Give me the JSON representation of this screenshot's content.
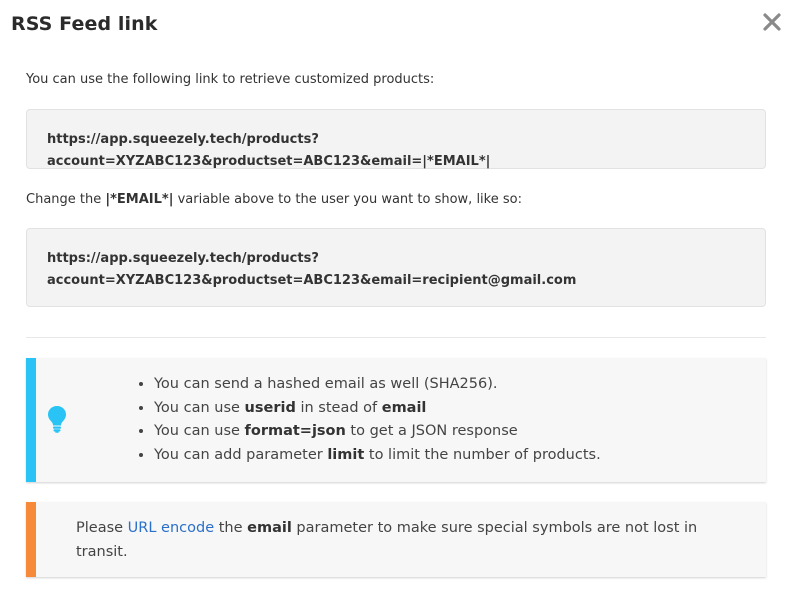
{
  "modal": {
    "title": "RSS Feed link",
    "close_icon": "close-icon"
  },
  "intro": {
    "text": "You can use the following link to retrieve customized products:"
  },
  "feed_link": {
    "url": "https://app.squeezely.tech/products?account=XYZABC123&productset=ABC123&email=|*EMAIL*|"
  },
  "change_note": {
    "prefix": "Change the ",
    "variable": "|*EMAIL*|",
    "suffix": " variable above to the user you want to show, like so:"
  },
  "example_link": {
    "line1": "https://app.squeezely.tech/products?",
    "line2": "account=XYZABC123&productset=ABC123&email=recipient@gmail.com"
  },
  "tips_callout": {
    "accent_color": "#29c3f5",
    "icon": "lightbulb-icon",
    "items": [
      {
        "pre": "You can send a hashed email as well (SHA256).",
        "bold": "",
        "mid": "",
        "bold2": "",
        "post": ""
      },
      {
        "pre": "You can use ",
        "bold": "userid",
        "mid": " in stead of ",
        "bold2": "email",
        "post": ""
      },
      {
        "pre": "You can use ",
        "bold": "format=json",
        "mid": " to get a JSON response",
        "bold2": "",
        "post": ""
      },
      {
        "pre": "You can add parameter ",
        "bold": "limit",
        "mid": " to limit the number of products.",
        "bold2": "",
        "post": ""
      }
    ]
  },
  "warning_callout": {
    "accent_color": "#f7893b",
    "pre": "Please ",
    "link": "URL encode",
    "mid": " the ",
    "bold": "email",
    "post": " parameter to make sure special symbols are not lost in transit."
  }
}
